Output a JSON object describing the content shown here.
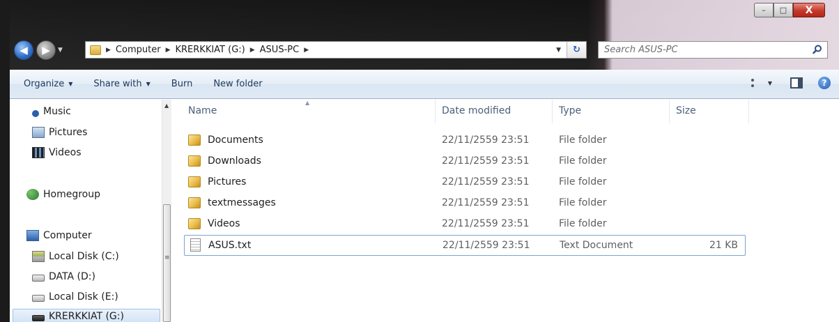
{
  "window": {
    "caption_buttons": {
      "minimize": "–",
      "maximize": "□",
      "close": "X"
    }
  },
  "nav": {
    "back_icon": "back-arrow-icon",
    "forward_icon": "forward-arrow-icon"
  },
  "address": {
    "crumbs": [
      "Computer",
      "KRERKKIAT (G:)",
      "ASUS-PC"
    ],
    "refresh_glyph": "↻"
  },
  "search": {
    "placeholder": "Search ASUS-PC"
  },
  "toolbar": {
    "organize": "Organize",
    "share_with": "Share with",
    "burn": "Burn",
    "new_folder": "New folder",
    "help": "?"
  },
  "sidebar": {
    "items": [
      {
        "label": "Music",
        "icon": "music-icon"
      },
      {
        "label": "Pictures",
        "icon": "pictures-icon"
      },
      {
        "label": "Videos",
        "icon": "videos-icon"
      },
      {
        "label": "Homegroup",
        "icon": "homegroup-icon"
      },
      {
        "label": "Computer",
        "icon": "computer-icon"
      },
      {
        "label": "Local Disk (C:)",
        "icon": "system-disk-icon"
      },
      {
        "label": "DATA (D:)",
        "icon": "disk-icon"
      },
      {
        "label": "Local Disk (E:)",
        "icon": "disk-icon"
      },
      {
        "label": "KRERKKIAT (G:)",
        "icon": "usb-drive-icon"
      }
    ]
  },
  "columns": {
    "name": "Name",
    "date": "Date modified",
    "type": "Type",
    "size": "Size"
  },
  "files": [
    {
      "name": "Documents",
      "date": "22/11/2559 23:51",
      "type": "File folder",
      "size": "",
      "icon": "folder-icon"
    },
    {
      "name": "Downloads",
      "date": "22/11/2559 23:51",
      "type": "File folder",
      "size": "",
      "icon": "folder-icon"
    },
    {
      "name": "Pictures",
      "date": "22/11/2559 23:51",
      "type": "File folder",
      "size": "",
      "icon": "folder-icon"
    },
    {
      "name": "textmessages",
      "date": "22/11/2559 23:51",
      "type": "File folder",
      "size": "",
      "icon": "folder-icon"
    },
    {
      "name": "Videos",
      "date": "22/11/2559 23:51",
      "type": "File folder",
      "size": "",
      "icon": "folder-icon"
    },
    {
      "name": "ASUS.txt",
      "date": "22/11/2559 23:51",
      "type": "Text Document",
      "size": "21 KB",
      "icon": "text-file-icon"
    }
  ]
}
